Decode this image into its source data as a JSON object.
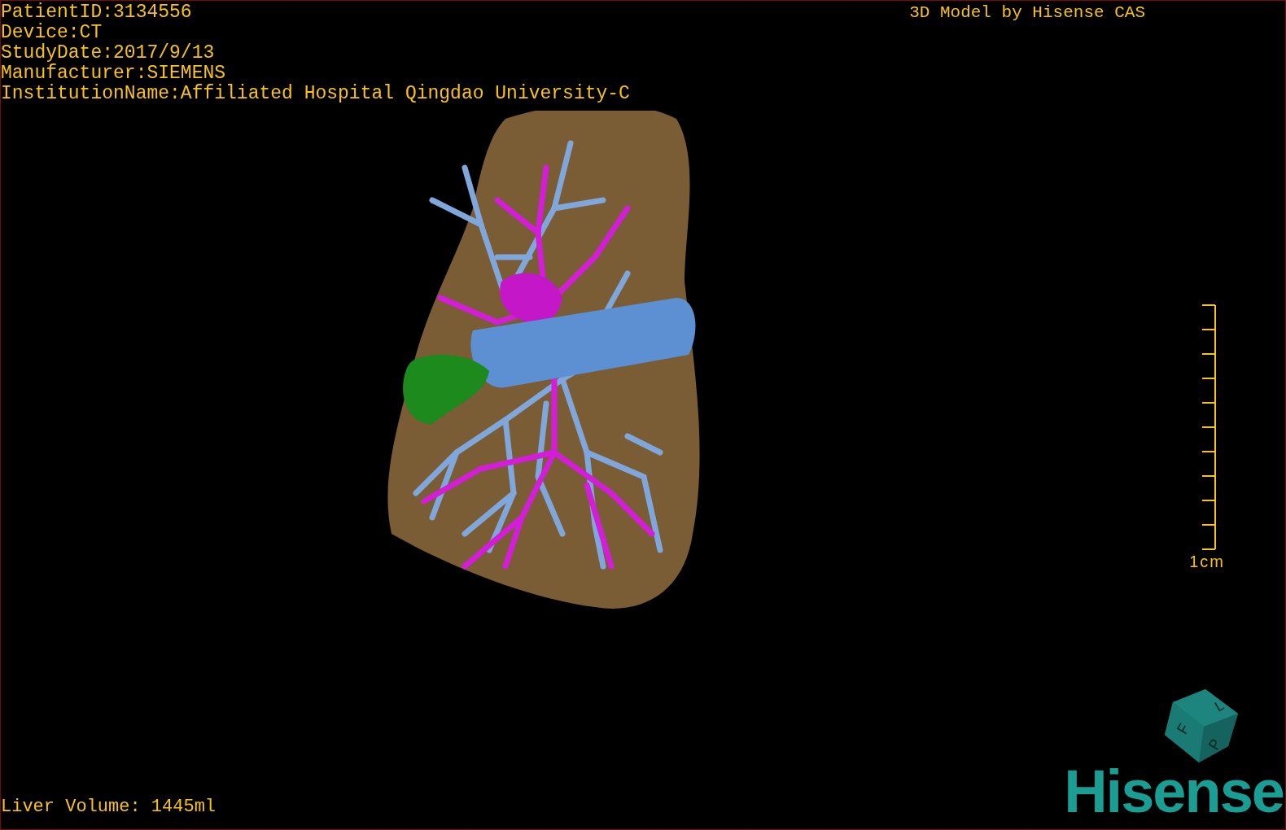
{
  "info_lines": [
    "PatientID:3134556",
    "Device:CT",
    "StudyDate:2017/9/13",
    "Manufacturer:SIEMENS",
    "InstitutionName:Affiliated Hospital Qingdao University-C"
  ],
  "title": "3D Model by Hisense CAS",
  "scale_bar": {
    "label": "1cm"
  },
  "volume": "Liver Volume: 1445ml",
  "orientation_cube": {
    "labels": [
      "F",
      "L",
      "P"
    ]
  },
  "logo": "Hisense"
}
